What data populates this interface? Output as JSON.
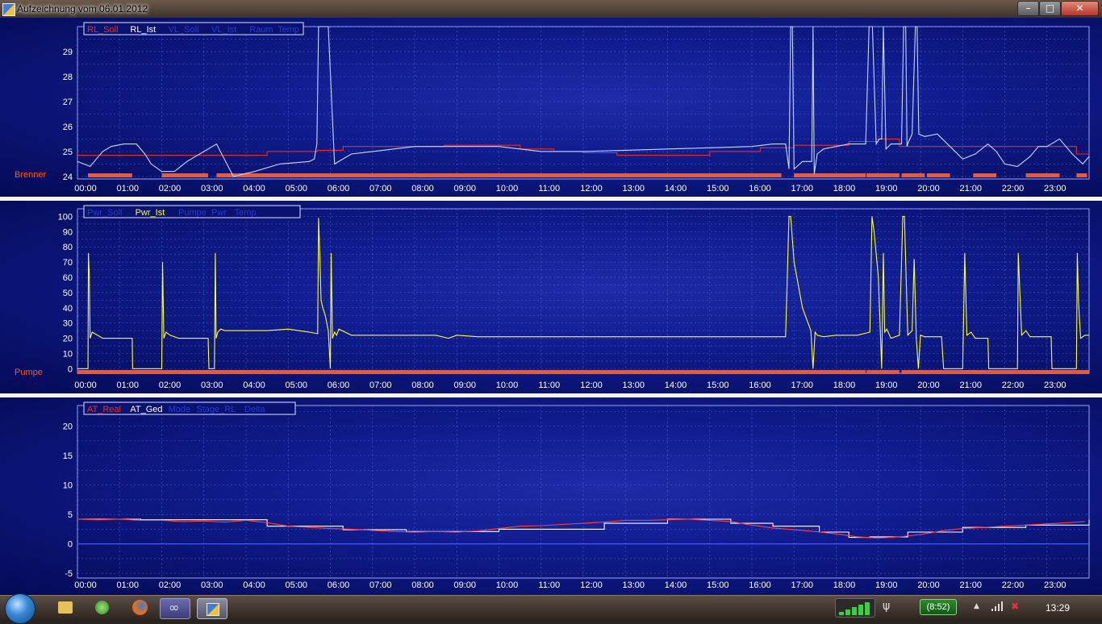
{
  "window": {
    "title": "Aufzeichnung vom 06.01.2012",
    "minimize": "–",
    "maximize": "□",
    "close": "✕"
  },
  "taskbar": {
    "battery": "(8:52)",
    "clock": "13:29",
    "icons": [
      "start-orb",
      "explorer-icon",
      "app-icon",
      "firefox-icon",
      "app-icon",
      "app-icon"
    ]
  },
  "colors": {
    "soll": "#e0302a",
    "ist": "#c8d8ff",
    "pwr": "#ffff33",
    "bar": "#ff5520",
    "grid": "#5a7cff",
    "plot_bg": "#0e1a8a"
  },
  "chart_data": [
    {
      "type": "line",
      "side_label": "Brenner",
      "legend": [
        "RL_Soll",
        "RL_Ist",
        "VL_Soll",
        "VL_Ist",
        "Raum",
        "Temp"
      ],
      "legend_colors": [
        "#e0302a",
        "#ffffff",
        "#2a3ad0",
        "#2a3ad0",
        "#2a3ad0",
        "#2a3ad0"
      ],
      "xticks": [
        "00:00",
        "01:00",
        "02:00",
        "03:00",
        "04:00",
        "05:00",
        "06:00",
        "07:00",
        "08:00",
        "09:00",
        "10:00",
        "11:00",
        "12:00",
        "13:00",
        "14:00",
        "15:00",
        "16:00",
        "17:00",
        "18:00",
        "19:00",
        "20:00",
        "21:00",
        "22:00",
        "23:00"
      ],
      "yticks": [
        24,
        25,
        26,
        27,
        28,
        29
      ],
      "ylim": [
        23.9,
        30.0
      ],
      "xlim": [
        0,
        24
      ],
      "series": [
        {
          "name": "RL_Soll",
          "color": "#e0302a",
          "step": true,
          "x": [
            0.0,
            3.3,
            4.5,
            5.7,
            6.3,
            8.7,
            10.5,
            11.3,
            12.0,
            12.8,
            15.0,
            16.2,
            17.0,
            18.3,
            19.0,
            19.5,
            23.7,
            24.0
          ],
          "y": [
            24.85,
            24.85,
            25.0,
            25.05,
            25.2,
            25.25,
            25.1,
            25.0,
            24.95,
            24.85,
            25.0,
            25.15,
            25.25,
            25.4,
            25.5,
            25.2,
            24.9,
            24.9
          ]
        },
        {
          "name": "RL_Ist",
          "color": "#c8d8ff",
          "step": false,
          "x": [
            0.0,
            0.3,
            0.45,
            0.6,
            0.8,
            1.1,
            1.4,
            1.6,
            1.75,
            2.0,
            2.3,
            2.6,
            3.0,
            3.2,
            3.3,
            3.7,
            4.2,
            4.8,
            5.5,
            5.62,
            5.68,
            5.72,
            5.75,
            5.78,
            5.82,
            5.9,
            5.95,
            6.1,
            6.5,
            7.0,
            8.0,
            9.0,
            10.0,
            11.0,
            12.0,
            13.0,
            14.0,
            15.0,
            16.0,
            16.5,
            16.8,
            16.88,
            16.92,
            16.96,
            17.0,
            17.2,
            17.42,
            17.45,
            17.48,
            17.55,
            17.7,
            18.0,
            18.3,
            18.7,
            18.78,
            18.82,
            18.86,
            18.95,
            19.02,
            19.08,
            19.12,
            19.18,
            19.3,
            19.55,
            19.6,
            19.65,
            19.68,
            19.72,
            19.8,
            19.88,
            19.92,
            19.96,
            20.1,
            20.4,
            20.7,
            21.0,
            21.3,
            21.6,
            21.8,
            22.0,
            22.3,
            22.6,
            22.8,
            23.0,
            23.3,
            23.6,
            23.85,
            24.0
          ],
          "y": [
            24.6,
            24.4,
            24.7,
            25.0,
            25.2,
            25.3,
            25.3,
            24.9,
            24.5,
            24.2,
            24.2,
            24.6,
            25.0,
            25.2,
            25.3,
            24.0,
            24.2,
            24.5,
            24.6,
            24.7,
            25.3,
            30.0,
            30.0,
            30.0,
            30.0,
            30.0,
            30.0,
            24.5,
            24.9,
            25.0,
            25.2,
            25.2,
            25.2,
            25.0,
            25.0,
            25.05,
            25.1,
            25.15,
            25.2,
            25.3,
            25.3,
            24.3,
            30.0,
            30.0,
            24.3,
            24.6,
            24.6,
            30.0,
            24.1,
            24.9,
            25.1,
            25.2,
            25.3,
            25.3,
            30.0,
            30.0,
            30.0,
            25.3,
            25.5,
            25.5,
            30.0,
            25.1,
            25.3,
            25.3,
            30.0,
            30.0,
            25.2,
            25.4,
            25.7,
            30.0,
            30.0,
            25.7,
            25.6,
            25.7,
            25.2,
            24.7,
            24.9,
            25.3,
            25.0,
            24.5,
            24.4,
            24.8,
            25.2,
            25.2,
            25.5,
            24.9,
            24.5,
            24.8
          ]
        }
      ],
      "bars": [
        [
          0.25,
          1.3
        ],
        [
          2.0,
          3.1
        ],
        [
          3.3,
          16.7
        ],
        [
          17.0,
          18.7
        ],
        [
          18.72,
          19.5
        ],
        [
          19.55,
          20.1
        ],
        [
          20.15,
          20.7
        ],
        [
          21.25,
          21.8
        ],
        [
          22.5,
          23.3
        ],
        [
          23.7,
          23.95
        ]
      ]
    },
    {
      "type": "line",
      "side_label": "Pumpe",
      "legend": [
        "Pwr_Soll",
        "Pwr_Ist",
        "Pumpe",
        "Pwr",
        "Temp"
      ],
      "legend_colors": [
        "#2a3ad0",
        "#ffff33",
        "#2a3ad0",
        "#2a3ad0",
        "#2a3ad0"
      ],
      "xticks": [
        "00:00",
        "01:00",
        "02:00",
        "03:00",
        "04:00",
        "05:00",
        "06:00",
        "07:00",
        "08:00",
        "09:00",
        "10:00",
        "11:00",
        "12:00",
        "13:00",
        "14:00",
        "15:00",
        "16:00",
        "17:00",
        "18:00",
        "19:00",
        "20:00",
        "21:00",
        "22:00",
        "23:00"
      ],
      "yticks": [
        0,
        10,
        20,
        30,
        40,
        50,
        60,
        70,
        80,
        90,
        100
      ],
      "ylim": [
        -3,
        105
      ],
      "xlim": [
        0,
        24
      ],
      "series": [
        {
          "name": "Pwr_Ist",
          "color": "#ffff33",
          "step": false,
          "x": [
            0.0,
            0.25,
            0.26,
            0.28,
            0.3,
            0.35,
            0.6,
            0.62,
            1.3,
            1.31,
            2.0,
            2.02,
            2.05,
            2.1,
            2.2,
            2.4,
            3.1,
            3.12,
            3.25,
            3.27,
            3.29,
            3.33,
            3.4,
            3.5,
            4.5,
            5.0,
            5.5,
            5.7,
            5.72,
            5.75,
            5.78,
            5.82,
            5.88,
            5.95,
            6.0,
            6.02,
            6.05,
            6.1,
            6.15,
            6.2,
            6.35,
            6.5,
            6.9,
            7.0,
            8.5,
            8.8,
            9.0,
            9.5,
            10.0,
            12.0,
            16.8,
            16.88,
            16.92,
            17.0,
            17.2,
            17.4,
            17.45,
            17.5,
            17.55,
            17.7,
            18.0,
            18.5,
            18.8,
            18.85,
            18.9,
            19.0,
            19.08,
            19.12,
            19.15,
            19.2,
            19.3,
            19.5,
            19.58,
            19.62,
            19.66,
            19.7,
            19.8,
            19.85,
            19.9,
            19.95,
            20.0,
            20.1,
            20.5,
            20.55,
            21.0,
            21.05,
            21.1,
            21.2,
            21.3,
            21.6,
            21.62,
            22.3,
            22.32,
            22.4,
            22.5,
            22.6,
            23.1,
            23.12,
            23.7,
            23.72,
            23.75,
            23.8,
            23.9,
            24.0
          ],
          "y": [
            0,
            0,
            76,
            63,
            20,
            24,
            20,
            20,
            20,
            0,
            0,
            70,
            20,
            24,
            22,
            20,
            20,
            0,
            0,
            76,
            20,
            24,
            26,
            25,
            25,
            26,
            24,
            23,
            99,
            75,
            45,
            40,
            35,
            25,
            0,
            76,
            20,
            24,
            22,
            26,
            24,
            22,
            22,
            22,
            22,
            20,
            22,
            21,
            21,
            21,
            21,
            100,
            100,
            70,
            40,
            25,
            0,
            24,
            22,
            21,
            22,
            22,
            24,
            100,
            90,
            60,
            0,
            76,
            24,
            26,
            20,
            22,
            100,
            100,
            60,
            22,
            25,
            72,
            20,
            0,
            22,
            21,
            21,
            0,
            0,
            76,
            22,
            24,
            20,
            20,
            0,
            0,
            76,
            22,
            25,
            21,
            21,
            0,
            0,
            76,
            44,
            20,
            22,
            22
          ]
        }
      ],
      "bars": [
        [
          0.0,
          18.7
        ],
        [
          18.72,
          19.5
        ],
        [
          19.55,
          24.0
        ]
      ]
    },
    {
      "type": "line",
      "side_label": "",
      "legend": [
        "AT_Real",
        "AT_Ged",
        "Mode",
        "Stage_RL",
        "Delta"
      ],
      "legend_colors": [
        "#e0302a",
        "#ffffff",
        "#2a3ad0",
        "#2a3ad0",
        "#2a3ad0"
      ],
      "xticks": [
        "00:00",
        "01:00",
        "02:00",
        "03:00",
        "04:00",
        "05:00",
        "06:00",
        "07:00",
        "08:00",
        "09:00",
        "10:00",
        "11:00",
        "12:00",
        "13:00",
        "14:00",
        "15:00",
        "16:00",
        "17:00",
        "18:00",
        "19:00",
        "20:00",
        "21:00",
        "22:00",
        "23:00"
      ],
      "yticks": [
        -5,
        0,
        5,
        10,
        15,
        20
      ],
      "ylim": [
        -5.8,
        23.5
      ],
      "xlim": [
        0,
        24
      ],
      "series": [
        {
          "name": "AT_Ged",
          "color": "#ffffff",
          "step": true,
          "x": [
            0.0,
            1.5,
            4.5,
            6.3,
            7.8,
            10.0,
            12.5,
            14.0,
            15.5,
            16.5,
            17.6,
            18.3,
            18.8,
            19.7,
            21.0,
            22.5,
            24.0
          ],
          "y": [
            4.2,
            4.1,
            3.0,
            2.4,
            2.1,
            2.5,
            3.5,
            4.2,
            3.5,
            3.0,
            2.0,
            1.1,
            1.2,
            2.0,
            2.8,
            3.2,
            4.1
          ]
        },
        {
          "name": "AT_Real",
          "color": "#ff4040",
          "step": false,
          "x": [
            0.0,
            0.5,
            1.0,
            1.5,
            2.0,
            2.5,
            3.0,
            3.5,
            4.0,
            4.5,
            5.0,
            5.5,
            6.0,
            6.5,
            7.0,
            7.5,
            8.0,
            8.5,
            9.0,
            9.5,
            10.0,
            10.5,
            11.0,
            11.5,
            12.0,
            12.5,
            13.0,
            13.5,
            14.0,
            14.5,
            15.0,
            15.5,
            16.0,
            16.5,
            17.0,
            17.5,
            18.0,
            18.5,
            19.0,
            19.5,
            20.0,
            20.5,
            21.0,
            21.5,
            22.0,
            22.5,
            23.0,
            23.5,
            23.9
          ],
          "y": [
            4.2,
            4.1,
            4.2,
            4.0,
            4.0,
            3.8,
            3.9,
            3.7,
            4.0,
            3.6,
            3.0,
            2.8,
            2.6,
            2.5,
            2.3,
            2.1,
            2.0,
            2.1,
            2.0,
            2.2,
            2.6,
            3.0,
            3.1,
            3.3,
            3.5,
            3.7,
            4.0,
            4.0,
            4.1,
            4.2,
            4.0,
            3.8,
            3.2,
            2.7,
            2.4,
            2.1,
            1.7,
            1.2,
            1.0,
            1.2,
            1.6,
            2.2,
            2.6,
            2.8,
            3.0,
            3.2,
            3.4,
            3.6,
            3.8
          ]
        }
      ],
      "bars": []
    }
  ]
}
